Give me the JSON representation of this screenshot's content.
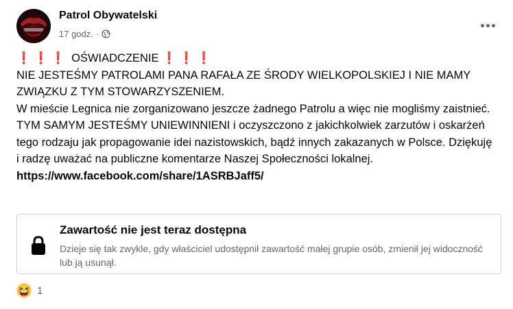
{
  "post": {
    "author": "Patrol Obywatelski",
    "time": "17 godz.",
    "separator": "·",
    "audience_icon": "globe-icon",
    "menu_icon": "more-horizontal-icon",
    "marks": "❗❗❗",
    "heading": "OŚWIADCZENIE",
    "line1": "NIE JESTEŚMY PATROLAMI PANA RAFAŁA ZE ŚRODY WIELKOPOLSKIEJ I NIE MAMY ZWIĄZKU Z TYM STOWARZYSZENIEM.",
    "line2": "W mieście Legnica nie zorganizowano jeszcze żadnego Patrolu a więc nie mogliśmy zaistnieć. TYM SAMYM JESTEŚMY UNIEWINNIENI i oczyszczono z jakichkolwiek zarzutów i oskarżeń tego rodzaju jak propagowanie idei nazistowskich, bądź innych zakazanych w Polsce. Dziękuję i radzę uważać na publiczne komentarze Naszej Społeczności lokalnej.",
    "link": "https://www.facebook.com/share/1ASRBJaff5/"
  },
  "unavailable": {
    "icon": "lock-icon",
    "title": "Zawartość nie jest teraz dostępna",
    "description": "Dzieje się tak zwykle, gdy właściciel udostępnił zawartość małej grupie osób, zmienił jej widoczność lub ją usunął."
  },
  "reactions": {
    "icon": "grinning-squinting-emoji-icon",
    "count": "1"
  },
  "colors": {
    "mark_red": "#e41e26",
    "secondary_text": "#65676b",
    "primary_text": "#050505",
    "border": "#ced0d4"
  }
}
